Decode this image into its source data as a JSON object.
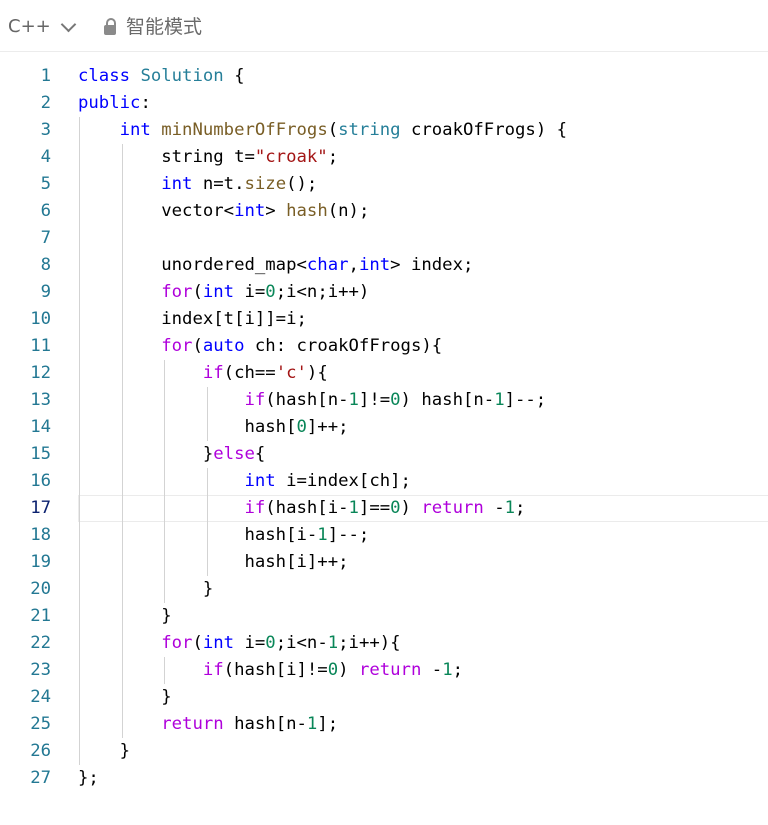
{
  "toolbar": {
    "language": "C++",
    "mode_label": "智能模式"
  },
  "editor": {
    "lines": [
      {
        "num": "1",
        "tokens": [
          {
            "t": "class",
            "c": "kw"
          },
          {
            "t": " "
          },
          {
            "t": "Solution",
            "c": "ty"
          },
          {
            "t": " {"
          }
        ]
      },
      {
        "num": "2",
        "tokens": [
          {
            "t": "public",
            "c": "kw"
          },
          {
            "t": ":"
          }
        ]
      },
      {
        "num": "3",
        "tokens": [
          {
            "t": "    "
          },
          {
            "t": "int",
            "c": "kw"
          },
          {
            "t": " "
          },
          {
            "t": "minNumberOfFrogs",
            "c": "fn"
          },
          {
            "t": "("
          },
          {
            "t": "string",
            "c": "ty"
          },
          {
            "t": " croakOfFrogs) {"
          }
        ]
      },
      {
        "num": "4",
        "tokens": [
          {
            "t": "        string t="
          },
          {
            "t": "\"croak\"",
            "c": "str"
          },
          {
            "t": ";"
          }
        ]
      },
      {
        "num": "5",
        "tokens": [
          {
            "t": "        "
          },
          {
            "t": "int",
            "c": "kw"
          },
          {
            "t": " n=t."
          },
          {
            "t": "size",
            "c": "fn"
          },
          {
            "t": "();"
          }
        ]
      },
      {
        "num": "6",
        "tokens": [
          {
            "t": "        vector<"
          },
          {
            "t": "int",
            "c": "kw"
          },
          {
            "t": "> "
          },
          {
            "t": "hash",
            "c": "fn"
          },
          {
            "t": "(n);"
          }
        ]
      },
      {
        "num": "7",
        "tokens": []
      },
      {
        "num": "8",
        "tokens": [
          {
            "t": "        unordered_map<"
          },
          {
            "t": "char",
            "c": "kw"
          },
          {
            "t": ","
          },
          {
            "t": "int",
            "c": "kw"
          },
          {
            "t": "> index;"
          }
        ]
      },
      {
        "num": "9",
        "tokens": [
          {
            "t": "        "
          },
          {
            "t": "for",
            "c": "ctl"
          },
          {
            "t": "("
          },
          {
            "t": "int",
            "c": "kw"
          },
          {
            "t": " i="
          },
          {
            "t": "0",
            "c": "num"
          },
          {
            "t": ";i<n;i++)"
          }
        ]
      },
      {
        "num": "10",
        "tokens": [
          {
            "t": "        index[t[i]]=i;"
          }
        ]
      },
      {
        "num": "11",
        "tokens": [
          {
            "t": "        "
          },
          {
            "t": "for",
            "c": "ctl"
          },
          {
            "t": "("
          },
          {
            "t": "auto",
            "c": "kw"
          },
          {
            "t": " ch: croakOfFrogs){"
          }
        ]
      },
      {
        "num": "12",
        "tokens": [
          {
            "t": "            "
          },
          {
            "t": "if",
            "c": "ctl"
          },
          {
            "t": "(ch=="
          },
          {
            "t": "'c'",
            "c": "str"
          },
          {
            "t": "){"
          }
        ]
      },
      {
        "num": "13",
        "tokens": [
          {
            "t": "                "
          },
          {
            "t": "if",
            "c": "ctl"
          },
          {
            "t": "(hash[n-"
          },
          {
            "t": "1",
            "c": "num"
          },
          {
            "t": "]!="
          },
          {
            "t": "0",
            "c": "num"
          },
          {
            "t": ") hash[n-"
          },
          {
            "t": "1",
            "c": "num"
          },
          {
            "t": "]--;"
          }
        ]
      },
      {
        "num": "14",
        "tokens": [
          {
            "t": "                hash["
          },
          {
            "t": "0",
            "c": "num"
          },
          {
            "t": "]++;"
          }
        ]
      },
      {
        "num": "15",
        "tokens": [
          {
            "t": "            }"
          },
          {
            "t": "else",
            "c": "ctl"
          },
          {
            "t": "{"
          }
        ]
      },
      {
        "num": "16",
        "tokens": [
          {
            "t": "                "
          },
          {
            "t": "int",
            "c": "kw"
          },
          {
            "t": " i=index[ch];"
          }
        ]
      },
      {
        "num": "17",
        "tokens": [
          {
            "t": "                "
          },
          {
            "t": "if",
            "c": "ctl"
          },
          {
            "t": "(hash[i-"
          },
          {
            "t": "1",
            "c": "num"
          },
          {
            "t": "]=="
          },
          {
            "t": "0",
            "c": "num"
          },
          {
            "t": ") "
          },
          {
            "t": "return",
            "c": "ctl"
          },
          {
            "t": " -"
          },
          {
            "t": "1",
            "c": "num"
          },
          {
            "t": ";"
          }
        ]
      },
      {
        "num": "18",
        "tokens": [
          {
            "t": "                hash[i-"
          },
          {
            "t": "1",
            "c": "num"
          },
          {
            "t": "]--;"
          }
        ]
      },
      {
        "num": "19",
        "tokens": [
          {
            "t": "                hash[i]++;"
          }
        ]
      },
      {
        "num": "20",
        "tokens": [
          {
            "t": "            }"
          }
        ]
      },
      {
        "num": "21",
        "tokens": [
          {
            "t": "        }"
          }
        ]
      },
      {
        "num": "22",
        "tokens": [
          {
            "t": "        "
          },
          {
            "t": "for",
            "c": "ctl"
          },
          {
            "t": "("
          },
          {
            "t": "int",
            "c": "kw"
          },
          {
            "t": " i="
          },
          {
            "t": "0",
            "c": "num"
          },
          {
            "t": ";i<n-"
          },
          {
            "t": "1",
            "c": "num"
          },
          {
            "t": ";i++){"
          }
        ]
      },
      {
        "num": "23",
        "tokens": [
          {
            "t": "            "
          },
          {
            "t": "if",
            "c": "ctl"
          },
          {
            "t": "(hash[i]!="
          },
          {
            "t": "0",
            "c": "num"
          },
          {
            "t": ") "
          },
          {
            "t": "return",
            "c": "ctl"
          },
          {
            "t": " -"
          },
          {
            "t": "1",
            "c": "num"
          },
          {
            "t": ";"
          }
        ]
      },
      {
        "num": "24",
        "tokens": [
          {
            "t": "        }"
          }
        ]
      },
      {
        "num": "25",
        "tokens": [
          {
            "t": "        "
          },
          {
            "t": "return",
            "c": "ctl"
          },
          {
            "t": " hash[n-"
          },
          {
            "t": "1",
            "c": "num"
          },
          {
            "t": "];"
          }
        ]
      },
      {
        "num": "26",
        "tokens": [
          {
            "t": "    }"
          }
        ]
      },
      {
        "num": "27",
        "tokens": [
          {
            "t": "};"
          }
        ]
      }
    ]
  }
}
